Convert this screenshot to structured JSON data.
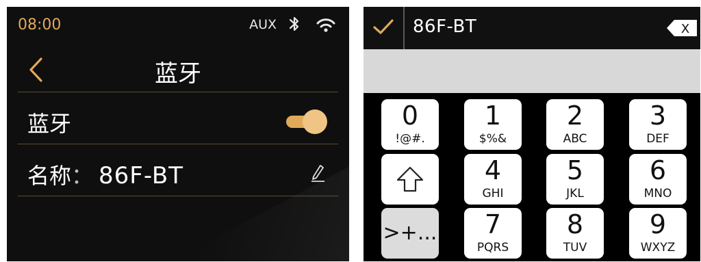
{
  "status": {
    "time": "08:00",
    "source": "AUX",
    "icons": [
      "bluetooth-icon",
      "wifi-icon"
    ],
    "accent_color": "#e0a95a"
  },
  "header": {
    "title": "蓝牙",
    "back_icon": "chevron-left-icon"
  },
  "bluetooth_row": {
    "label": "蓝牙",
    "toggle_on": true
  },
  "name_row": {
    "label": "名称",
    "separator": "：",
    "value": "86F-BT",
    "edit_icon": "pencil-icon"
  },
  "keypad": {
    "input_value": "86F-BT",
    "confirm_icon": "check-icon",
    "backspace_label": "X",
    "keys": [
      {
        "digit": "0",
        "letters": "!@#."
      },
      {
        "digit": "1",
        "letters": "$%&"
      },
      {
        "digit": "2",
        "letters": "ABC"
      },
      {
        "digit": "3",
        "letters": "DEF"
      },
      {
        "digit": "4",
        "letters": "GHI"
      },
      {
        "digit": "5",
        "letters": "JKL"
      },
      {
        "digit": "6",
        "letters": "MNO"
      },
      {
        "digit": "7",
        "letters": "PQRS"
      },
      {
        "digit": "8",
        "letters": "TUV"
      },
      {
        "digit": "9",
        "letters": "WXYZ"
      }
    ],
    "shift_icon": "shift-arrow-icon",
    "symbols_label": ">+..."
  }
}
